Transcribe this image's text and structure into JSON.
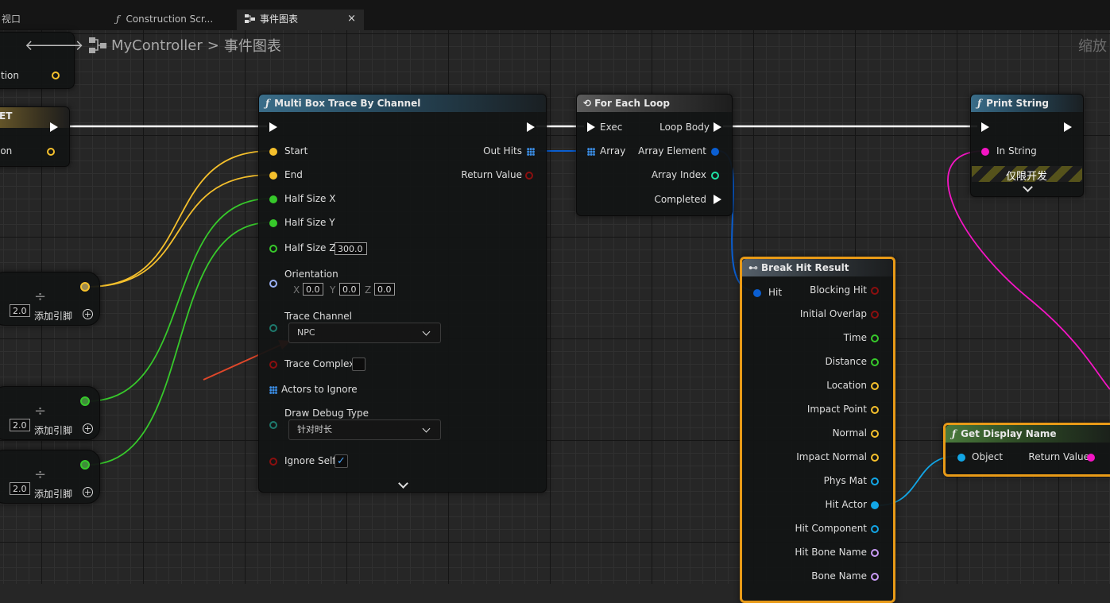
{
  "tabs": [
    {
      "label": "视口"
    },
    {
      "label": "Construction Scr...",
      "icon": "function-icon"
    },
    {
      "label": "事件图表",
      "icon": "event-graph-icon",
      "close": "×"
    }
  ],
  "breadcrumb": {
    "root": "MyController",
    "sep": ">",
    "current": "事件图表"
  },
  "zoom_label": "缩放",
  "left_nodes": {
    "top_pin_label": "tion",
    "event_header": "ET",
    "event_pin_label": "ion",
    "divide_value": "2.0",
    "add_pin_label": "添加引脚"
  },
  "multibox": {
    "title": "Multi Box Trace By Channel",
    "start": "Start",
    "end": "End",
    "half_x": "Half Size X",
    "half_y": "Half Size Y",
    "half_z": "Half Size Z",
    "half_z_value": "300.0",
    "orientation": "Orientation",
    "x_label": "X",
    "x_value": "0.0",
    "y_label": "Y",
    "y_value": "0.0",
    "z_label": "Z",
    "z_value": "0.0",
    "trace_channel": "Trace Channel",
    "trace_channel_value": "NPC",
    "trace_complex": "Trace Complex",
    "actors_to_ignore": "Actors to Ignore",
    "draw_debug_type": "Draw Debug Type",
    "draw_debug_value": "针对时长",
    "ignore_self": "Ignore Self",
    "check_mark": "✓",
    "out_hits": "Out Hits",
    "return_value": "Return Value"
  },
  "foreach": {
    "title": "For Each Loop",
    "exec": "Exec",
    "loop_body": "Loop Body",
    "array": "Array",
    "array_element": "Array Element",
    "array_index": "Array Index",
    "completed": "Completed"
  },
  "print": {
    "title": "Print String",
    "in_string": "In String",
    "dev_only": "仅限开发"
  },
  "break_hit": {
    "title": "Break Hit Result",
    "hit": "Hit",
    "outputs": [
      "Blocking Hit",
      "Initial Overlap",
      "Time",
      "Distance",
      "Location",
      "Impact Point",
      "Normal",
      "Impact Normal",
      "Phys Mat",
      "Hit Actor",
      "Hit Component",
      "Hit Bone Name",
      "Bone Name"
    ]
  },
  "display_name": {
    "title": "Get Display Name",
    "object": "Object",
    "return_value": "Return Value"
  },
  "colors": {
    "exec": "#ffffff",
    "vector": "#f5c02c",
    "float": "#37c92b",
    "rotator": "#9ab0f5",
    "byte": "#1e7a6e",
    "bool": "#8b0f0f",
    "struct": "#0a5ed1",
    "int": "#1ee0a4",
    "string": "#f415c4",
    "object": "#12a6e6",
    "name": "#c99bf5",
    "annotation_arrow": "#e0472a",
    "selection": "#e89a17"
  }
}
